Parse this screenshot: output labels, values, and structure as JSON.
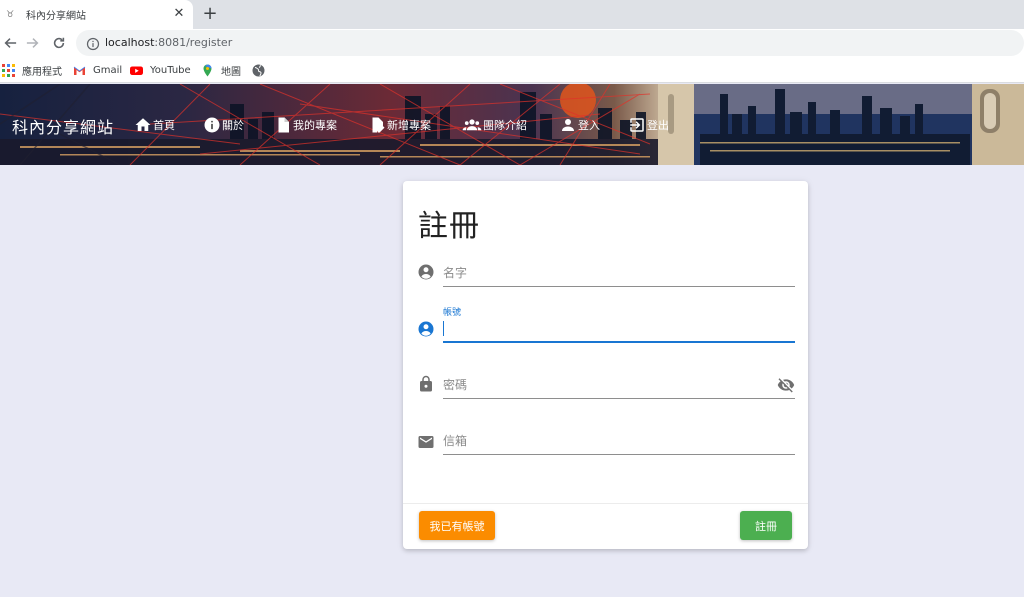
{
  "browser": {
    "tab_title": "科內分享網站",
    "url_host": "localhost",
    "url_path": ":8081/register",
    "bookmarks": [
      {
        "label": "應用程式",
        "icon": "apps-grid-icon"
      },
      {
        "label": "Gmail",
        "icon": "gmail-icon"
      },
      {
        "label": "YouTube",
        "icon": "youtube-icon"
      },
      {
        "label": "地圖",
        "icon": "maps-pin-icon"
      },
      {
        "label": "",
        "icon": "globe-icon"
      }
    ]
  },
  "header": {
    "brand": "科內分享網站",
    "nav": [
      {
        "label": "首頁",
        "icon": "home-icon"
      },
      {
        "label": "關於",
        "icon": "info-icon"
      },
      {
        "label": "我的專案",
        "icon": "file-icon"
      },
      {
        "label": "新增專案",
        "icon": "file-edit-icon"
      },
      {
        "label": "團隊介紹",
        "icon": "group-icon"
      },
      {
        "label": "登入",
        "icon": "person-icon"
      },
      {
        "label": "登出",
        "icon": "logout-icon"
      }
    ]
  },
  "form": {
    "title": "註冊",
    "name_placeholder": "名字",
    "account_label": "帳號",
    "account_value": "",
    "password_placeholder": "密碼",
    "email_placeholder": "信箱",
    "login_button": "我已有帳號",
    "register_button": "註冊"
  },
  "colors": {
    "accent": "#1976d2",
    "login_button": "#fb8c00",
    "register_button": "#4caf50",
    "page_background": "#e8e9f5"
  }
}
